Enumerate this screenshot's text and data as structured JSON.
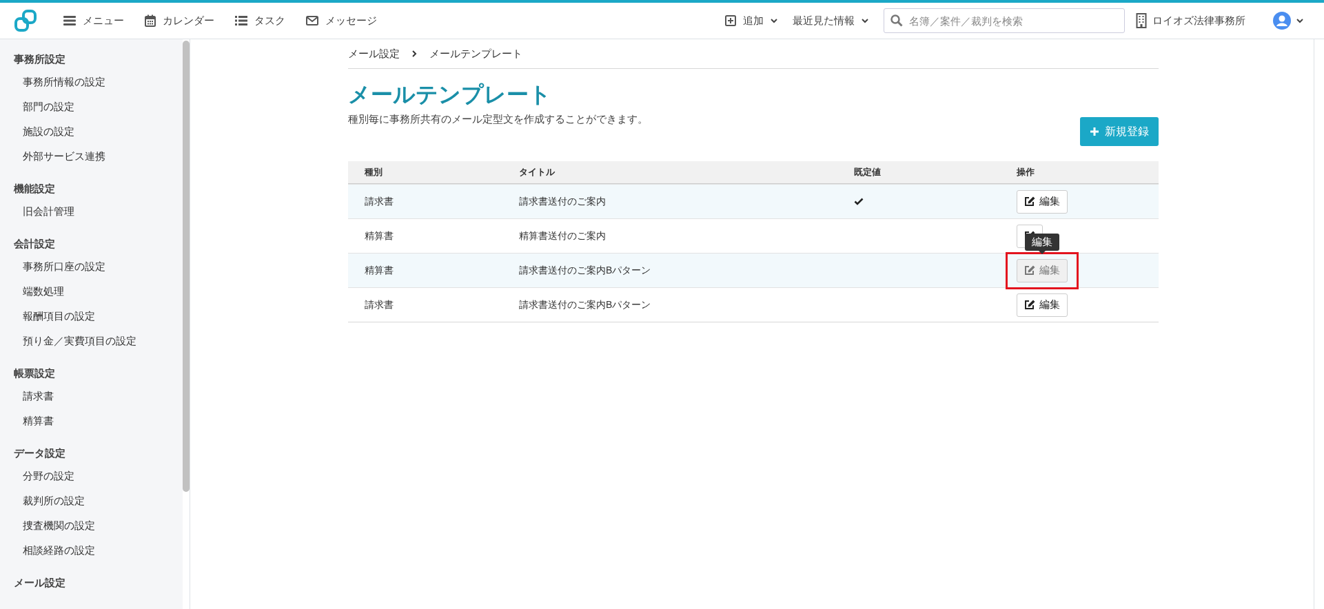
{
  "top_bar": {
    "nav": [
      {
        "kind": "menu",
        "label": "メニュー"
      },
      {
        "kind": "calendar",
        "label": "カレンダー"
      },
      {
        "kind": "tasks",
        "label": "タスク"
      },
      {
        "kind": "messages",
        "label": "メッセージ"
      }
    ],
    "add": "追加",
    "recent": "最近見た情報",
    "search": {
      "placeholder": "名簿／案件／裁判を検索"
    },
    "office": "ロイオズ法律事務所"
  },
  "sidebar": {
    "groups": [
      {
        "heading": "事務所設定",
        "items": [
          "事務所情報の設定",
          "部門の設定",
          "施設の設定",
          "外部サービス連携"
        ]
      },
      {
        "heading": "機能設定",
        "items": [
          "旧会計管理"
        ]
      },
      {
        "heading": "会計設定",
        "items": [
          "事務所口座の設定",
          "端数処理",
          "報酬項目の設定",
          "預り金／実費項目の設定"
        ]
      },
      {
        "heading": "帳票設定",
        "items": [
          "請求書",
          "精算書"
        ]
      },
      {
        "heading": "データ設定",
        "items": [
          "分野の設定",
          "裁判所の設定",
          "捜査機関の設定",
          "相談経路の設定"
        ]
      },
      {
        "heading": "メール設定"
      }
    ]
  },
  "breadcrumb": [
    "メール設定",
    "メールテンプレート"
  ],
  "page": {
    "title": "メールテンプレート",
    "description": "種別毎に事務所共有のメール定型文を作成することができます。",
    "new_button": "新規登録"
  },
  "table": {
    "columns": [
      "種別",
      "タイトル",
      "既定値",
      "操作"
    ],
    "rows": [
      {
        "type": "請求書",
        "title": "請求書送付のご案内",
        "default": true,
        "action": "編集",
        "hovered": false
      },
      {
        "type": "精算書",
        "title": "精算書送付のご案内",
        "default": false,
        "hovered": false
      },
      {
        "type": "精算書",
        "title": "請求書送付のご案内Bパターン",
        "default": false,
        "action": "編集",
        "hovered": true,
        "tooltip": "編集",
        "highlighted": true
      },
      {
        "type": "請求書",
        "title": "請求書送付のご案内Bパターン",
        "default": false,
        "action": "編集",
        "hovered": false
      }
    ]
  }
}
